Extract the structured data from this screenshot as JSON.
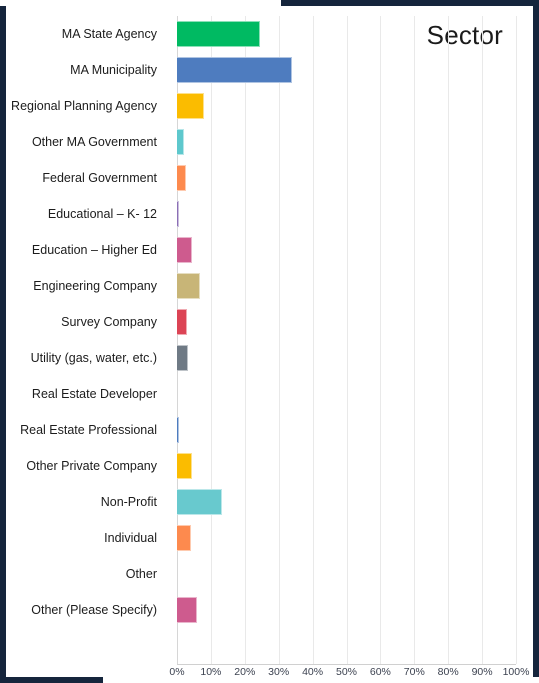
{
  "slide": {
    "title": "Sector",
    "frame_color": "#15253c",
    "background": "#ffffff"
  },
  "chart_data": {
    "type": "bar",
    "orientation": "horizontal",
    "title": "Sector",
    "xlabel": "",
    "ylabel": "",
    "xlim": [
      0,
      100
    ],
    "xtick_labels": [
      "0%",
      "10%",
      "20%",
      "30%",
      "40%",
      "50%",
      "60%",
      "70%",
      "80%",
      "90%",
      "100%"
    ],
    "xtick_values": [
      0,
      10,
      20,
      30,
      40,
      50,
      60,
      70,
      80,
      90,
      100
    ],
    "grid": true,
    "legend": "none",
    "value_unit": "percent",
    "categories": [
      "MA State Agency",
      "MA Municipality",
      "Regional Planning Agency",
      "Other MA Government",
      "Federal Government",
      "Educational – K- 12",
      "Education – Higher Ed",
      "Engineering Company",
      "Survey Company",
      "Utility (gas, water, etc.)",
      "Real Estate Developer",
      "Real Estate Professional",
      "Other Private Company",
      "Non-Profit",
      "Individual",
      "Other",
      "Other (Please Specify)"
    ],
    "values": [
      24.5,
      34.0,
      8.0,
      2.0,
      2.6,
      0.3,
      4.4,
      6.7,
      3.0,
      3.2,
      0.0,
      0.6,
      4.5,
      13.2,
      4.0,
      0.0,
      5.8
    ],
    "colors": [
      "#00ba62",
      "#4e7cbf",
      "#fbbc00",
      "#5ec8cd",
      "#fd8a4e",
      "#8b6fb5",
      "#ce5b8e",
      "#c8b577",
      "#dc4455",
      "#6f7a85",
      "#8fb3e0",
      "#4e7cbf",
      "#fbbc00",
      "#68c9ce",
      "#fd8a4e",
      "#d0d0d0",
      "#ce5b8e"
    ]
  }
}
